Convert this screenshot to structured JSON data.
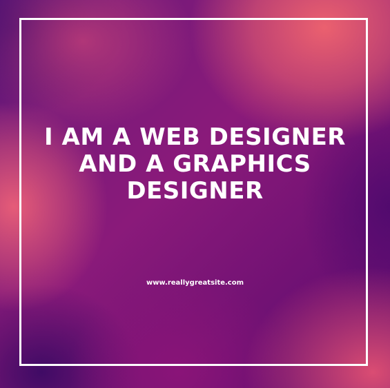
{
  "headline": {
    "line1": "I AM A WEB DESIGNER",
    "line2": "AND A GRAPHICS",
    "line3": "DESIGNER"
  },
  "website": "www.reallygreatsite.com",
  "colors": {
    "frame": "#ffffff",
    "text": "#ffffff",
    "gradient_pink": "#f0646e",
    "gradient_purple": "#5a0a6e",
    "gradient_magenta": "#8a1a7a"
  }
}
